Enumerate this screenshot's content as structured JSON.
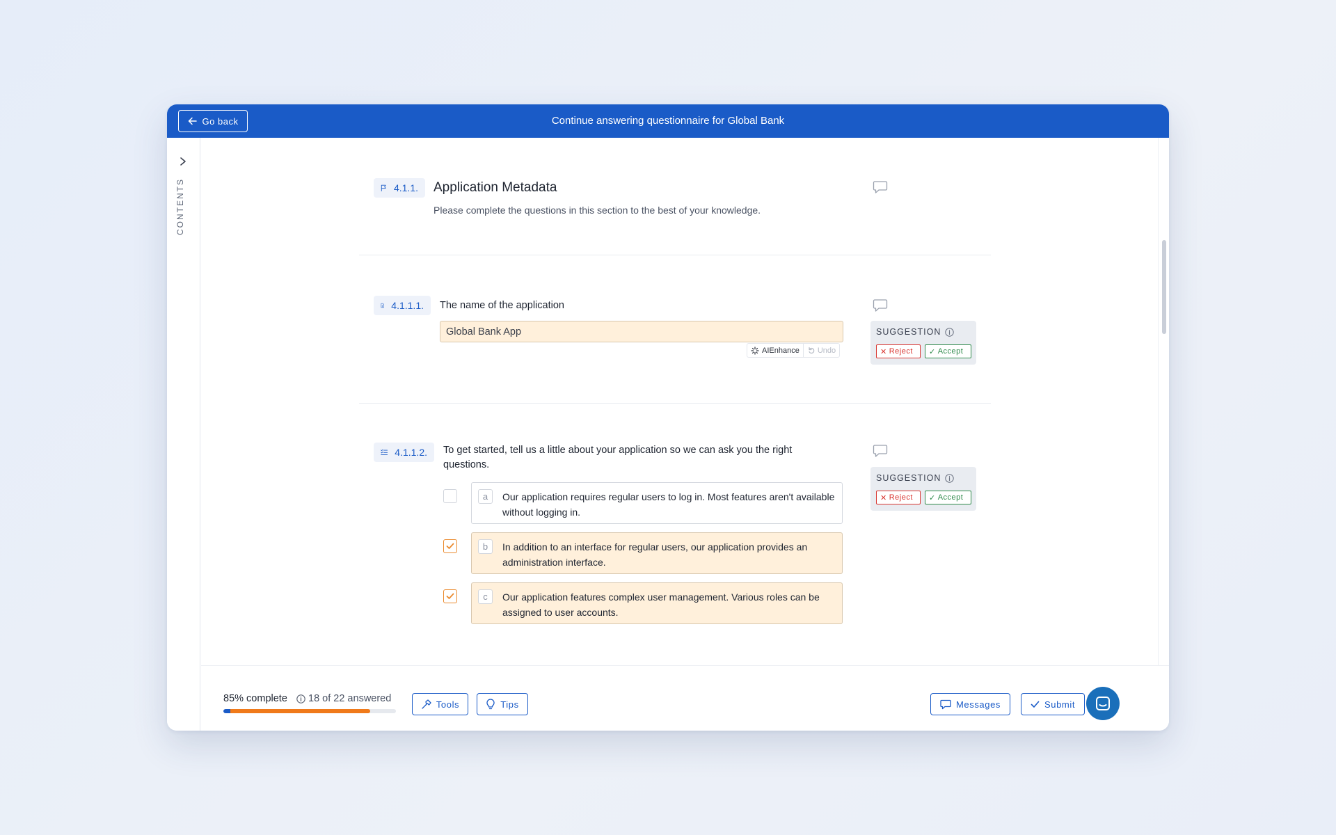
{
  "header": {
    "back_label": "Go back",
    "title": "Continue answering questionnaire for Global Bank"
  },
  "sidebar": {
    "label": "CONTENTS"
  },
  "section": {
    "number": "4.1.1.",
    "title": "Application Metadata",
    "description": "Please complete the questions in this section to the best of your knowledge.",
    "icon": "flag-icon"
  },
  "questions": [
    {
      "number": "4.1.1.1.",
      "icon": "document-icon",
      "text": "The name of the application",
      "answer": "Global Bank App",
      "ai_enhance_label": "AIEnhance",
      "undo_label": "Undo"
    },
    {
      "number": "4.1.1.2.",
      "icon": "checklist-icon",
      "text": "To get started, tell us a little about your application so we can ask you the right questions.",
      "options": [
        {
          "letter": "a",
          "text": "Our application requires regular users to log in. Most features aren't available without logging in.",
          "checked": false
        },
        {
          "letter": "b",
          "text": "In addition to an interface for regular users, our application provides an administration interface.",
          "checked": true
        },
        {
          "letter": "c",
          "text": "Our application features complex user management. Various roles can be assigned to user accounts.",
          "checked": true
        }
      ]
    }
  ],
  "suggestion": {
    "title": "SUGGESTION",
    "reject_label": "Reject",
    "accept_label": "Accept"
  },
  "footer": {
    "progress_percent": 85,
    "progress_label": "85% complete",
    "answered_label": "18 of 22 answered",
    "tools_label": "Tools",
    "tips_label": "Tips",
    "messages_label": "Messages",
    "submit_label": "Submit"
  },
  "colors": {
    "brand_blue": "#1a5bc7",
    "progress_orange": "#f07a1a",
    "suggested_fill": "#fff0db",
    "reject_red": "#d9342f",
    "accept_green": "#2e8a4a"
  }
}
